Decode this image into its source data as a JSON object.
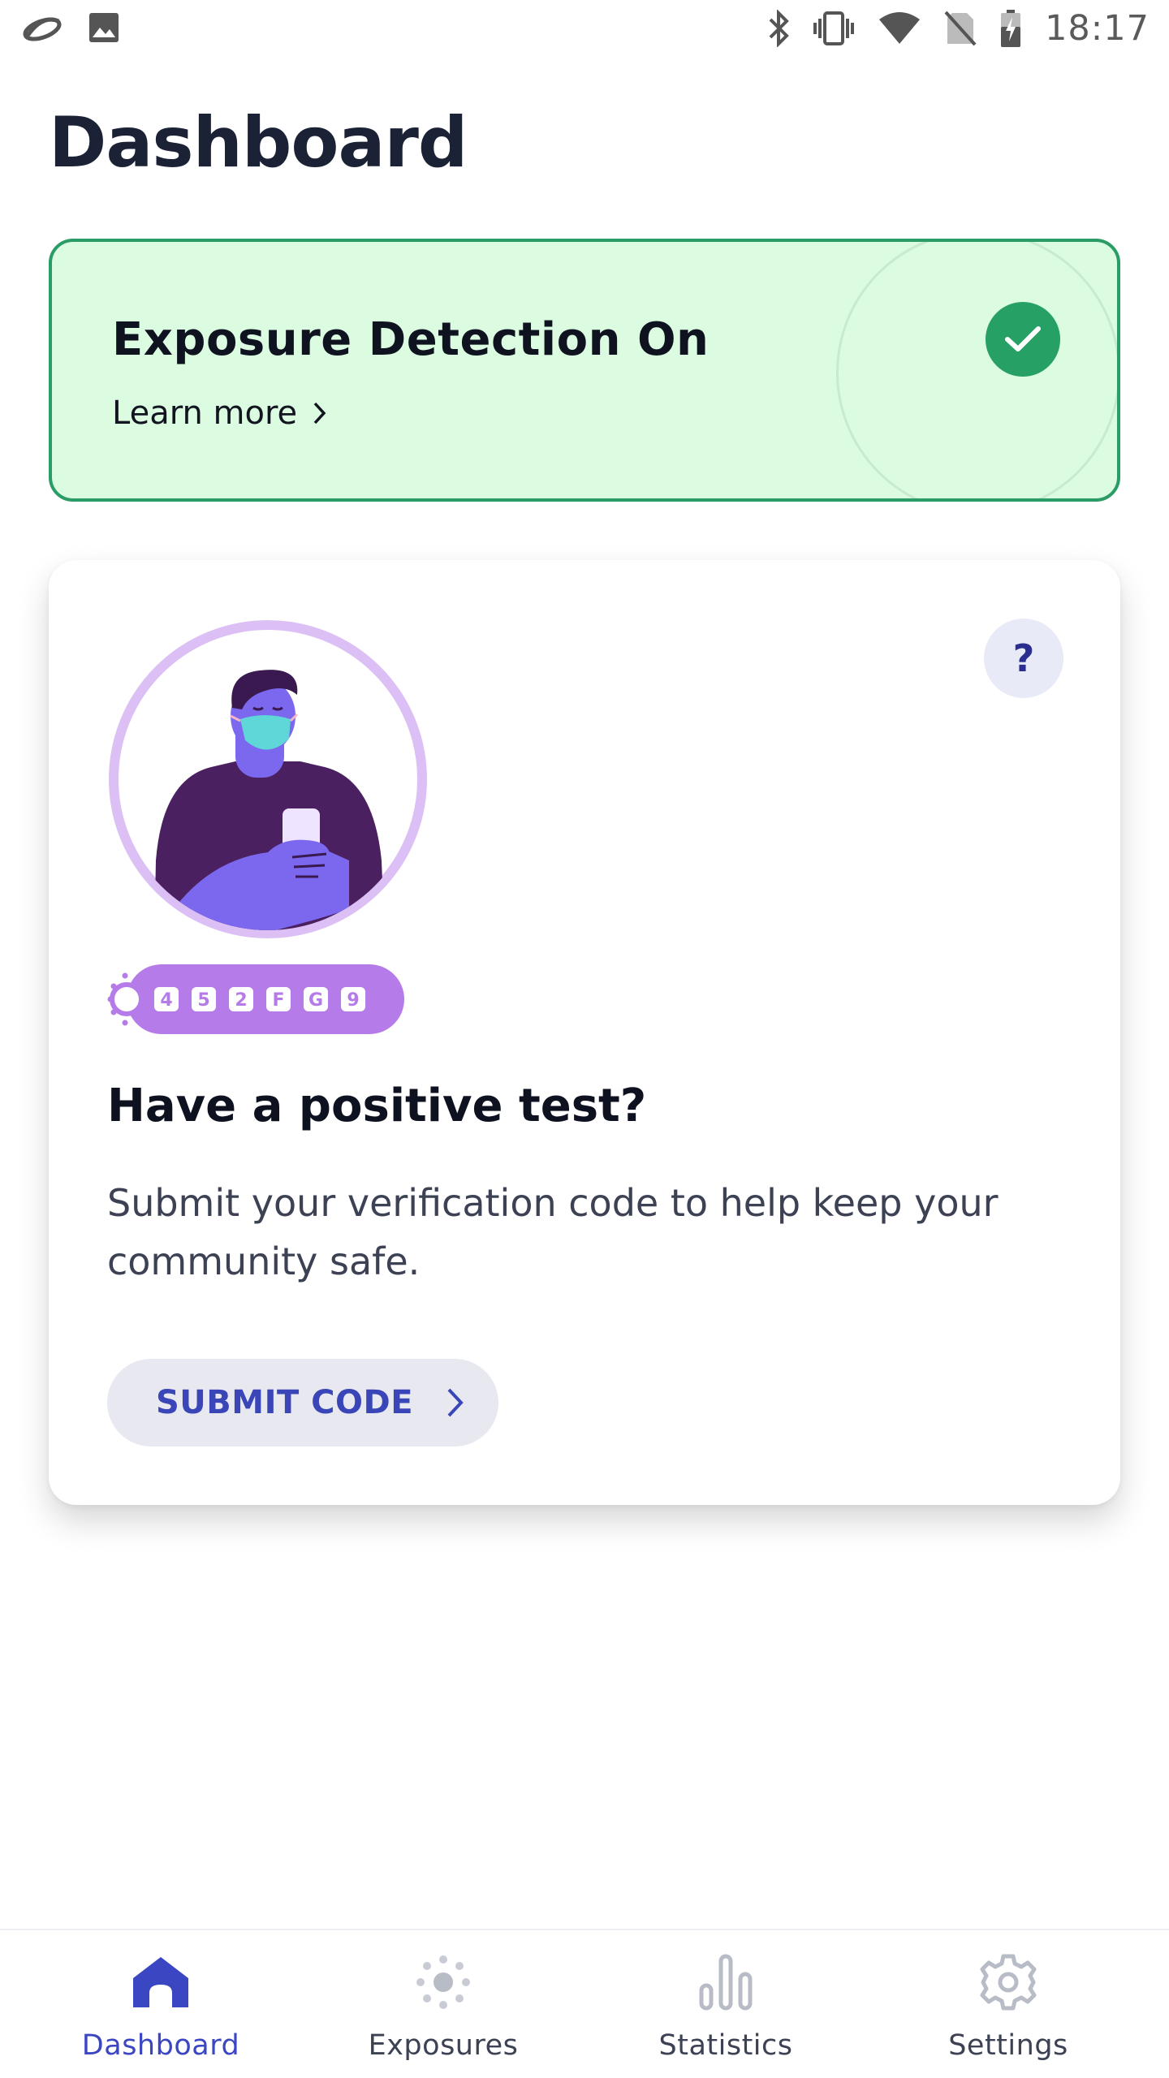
{
  "status_bar": {
    "time": "18:17",
    "left_icons": [
      "cloud-app-icon",
      "image-icon"
    ],
    "right_icons": [
      "bluetooth-icon",
      "vibrate-icon",
      "wifi-icon",
      "no-sim-icon",
      "battery-charging-icon"
    ]
  },
  "page": {
    "title": "Dashboard"
  },
  "exposure": {
    "title": "Exposure Detection On",
    "learn_more": "Learn more",
    "status_icon": "check-icon",
    "accent_color": "#26a064",
    "background_color": "#dcfce2"
  },
  "positive_test": {
    "help_label": "?",
    "code_characters": [
      "4",
      "5",
      "2",
      "F",
      "G",
      "9"
    ],
    "heading": "Have a positive test?",
    "body": "Submit your verification code to help keep your community safe.",
    "submit_label": "SUBMIT CODE"
  },
  "bottom_nav": {
    "active_color": "#3b47c2",
    "items": [
      {
        "label": "Dashboard",
        "icon": "home-icon",
        "active": true
      },
      {
        "label": "Exposures",
        "icon": "exposure-icon",
        "active": false
      },
      {
        "label": "Statistics",
        "icon": "bar-chart-icon",
        "active": false
      },
      {
        "label": "Settings",
        "icon": "gear-icon",
        "active": false
      }
    ]
  }
}
